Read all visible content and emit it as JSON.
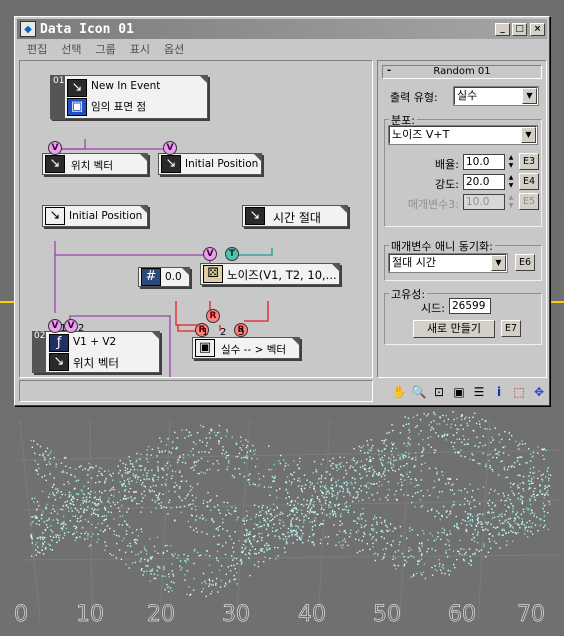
{
  "window": {
    "title": "Data Icon 01",
    "buttons": [
      "_",
      "□",
      "×"
    ]
  },
  "menu": [
    "편집",
    "선택",
    "그룹",
    "표시",
    "옵션"
  ],
  "nodes": {
    "event": {
      "number": "01",
      "line1": "New In Event",
      "line2": "임의 표면 점"
    },
    "pos_vector": {
      "label": "위치 벡터"
    },
    "initial_pos_a": {
      "label": "Initial Position"
    },
    "initial_pos_b": {
      "label": "Initial Position"
    },
    "abs_time": {
      "label": "시간 절대"
    },
    "const": {
      "label": "0.0"
    },
    "noise": {
      "label": "노이즈(V1, T2, 10,..."
    },
    "real_to_vec": {
      "label": "실수 -- > 벡터"
    },
    "expr": {
      "number": "02",
      "line1": "V1 + V2",
      "line2": "위치 벡터"
    },
    "balls": {
      "v": "V",
      "r": "R",
      "t": "T"
    },
    "ports": [
      "1",
      "2",
      "1",
      "2",
      "3"
    ]
  },
  "panel": {
    "rollout_title": "Random 01",
    "rollout_toggle": "-",
    "output_type_label": "출력 유형:",
    "output_type_value": "실수",
    "distribution_group": "분포:",
    "distribution_value": "노이즈 V+T",
    "scale_label": "배율:",
    "scale_value": "10.0",
    "scale_btn": "E3",
    "strength_label": "강도:",
    "strength_value": "20.0",
    "strength_btn": "E4",
    "param3_label": "매개변수3:",
    "param3_value": "10.0",
    "param3_btn": "E5",
    "anim_sync_group": "매개변수 애니 동기화:",
    "anim_sync_value": "절대 시간",
    "anim_sync_btn": "E6",
    "unique_group": "고유성:",
    "seed_label": "시드:",
    "seed_value": "26599",
    "new_button": "새로 만들기",
    "new_btn_code": "E7"
  },
  "toolbar_icons": [
    "hand-icon",
    "zoom-icon",
    "zoom-region-icon",
    "frame-icon",
    "list-icon",
    "info-icon",
    "select-icon",
    "move-icon"
  ],
  "axis_ticks": [
    "0",
    "10",
    "20",
    "30",
    "40",
    "50",
    "60",
    "70"
  ]
}
